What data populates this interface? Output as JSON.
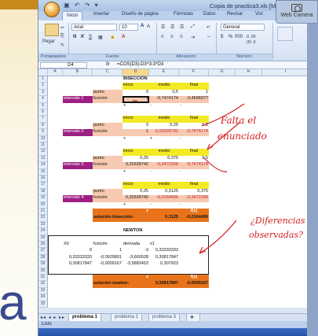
{
  "window": {
    "title": "Copia de practica3.xls  [Modo de c",
    "qat_icons": [
      "save-icon",
      "undo-icon",
      "redo-icon"
    ],
    "tabs": [
      "Inicio",
      "Insertar",
      "Diseño de página",
      "Fórmulas",
      "Datos",
      "Revisar",
      "Vist"
    ]
  },
  "webcam": {
    "label": "Web Camera"
  },
  "ribbon": {
    "paste_label": "Pegar",
    "font_name": "Arial",
    "font_size": "10",
    "bold": "N",
    "italic": "K",
    "underline": "S",
    "font_grow": "A",
    "font_shrink": "A",
    "number_format": "General",
    "percent": "%",
    "thousands": "000",
    "dec_inc": ",0 ,00",
    "dec_dec": ",00 ,0",
    "groups": [
      "Portapapeles",
      "Fuente",
      "Alineación",
      "Número"
    ]
  },
  "formula_bar": {
    "name_box": "D4",
    "fx": "fx",
    "formula": "=COS(D3)-D3^3-3*D3"
  },
  "columns": [
    "A",
    "B",
    "C",
    "D",
    "E",
    "F",
    "G",
    "H",
    "I"
  ],
  "rows": [
    "1",
    "2",
    "3",
    "4",
    "5",
    "6",
    "7",
    "8",
    "9",
    "10",
    "11",
    "12",
    "13",
    "14",
    "15",
    "16",
    "17",
    "18",
    "19",
    "20",
    "21",
    "22",
    "23",
    "24",
    "25",
    "26",
    "27",
    "28",
    "29",
    "30",
    "31",
    "32",
    "33",
    "34",
    "35"
  ],
  "sheet": {
    "bisection_title": "BISECCIÓN",
    "inicio": "inicio",
    "medio": "medio",
    "final": "final",
    "punto": "punto",
    "funcion": "función",
    "plus": "+",
    "minus": "-",
    "interval_1": "intervalo 1",
    "interval_2": "intervalo 2",
    "interval_3": "intervalo 3",
    "interval_4": "intervalo 4",
    "i1": {
      "p": [
        "0",
        "0,5",
        "1"
      ],
      "f": [
        "1",
        "-0,7474174",
        "-3,4596977"
      ],
      "s": [
        "+",
        "-",
        "-"
      ]
    },
    "i2": {
      "p": [
        "0",
        "0,25",
        "0,5"
      ],
      "f": [
        "1",
        "0,20328742",
        "-0,7474174"
      ],
      "s": [
        "+",
        "+",
        "-"
      ]
    },
    "i3": {
      "p": [
        "0,25",
        "0,375",
        "0,5"
      ],
      "f": [
        "0,20328742",
        "-0,2472268",
        "-0,7474174"
      ],
      "s": [
        "+",
        "-",
        "-"
      ]
    },
    "i4": {
      "p": [
        "0,25",
        "0,3125",
        "0,375"
      ],
      "f": [
        "0,20328742",
        "-0,0164496",
        "-0,2472268"
      ],
      "s": [
        "+",
        "-",
        "-"
      ]
    },
    "sol_x_label": "x",
    "sol_fx_label": "f(x)",
    "sol_bisection_label": "solución bisección:",
    "sol_bisection_x": "0,3125",
    "sol_bisection_fx": "-0,0164496",
    "newton_title": "NEWTON",
    "newton_headers": [
      "X0",
      "función",
      "derivada",
      "x1"
    ],
    "newton_rows": [
      [
        "0",
        "1",
        "-3",
        "0,33333333"
      ],
      [
        "0,33333333",
        "-0,0920801",
        "-3,660528",
        "0,30817847"
      ],
      [
        "0,30817847",
        "-0,0009167",
        "-3,5882453",
        "0,307923"
      ]
    ],
    "sol_newton_label": "solución newton:",
    "sol_newton_x": "0,30817847",
    "sol_newton_fx": "-0,0009167"
  },
  "annotations": {
    "note1_line1": "Falta el",
    "note1_line2": "enunciado",
    "note2_line1": "¿Diferencias",
    "note2_line2": "observadas?"
  },
  "sheet_tabs": [
    "problema 1",
    "problema 2",
    "problema 3"
  ],
  "status": "Listo",
  "background_glyph": "a"
}
